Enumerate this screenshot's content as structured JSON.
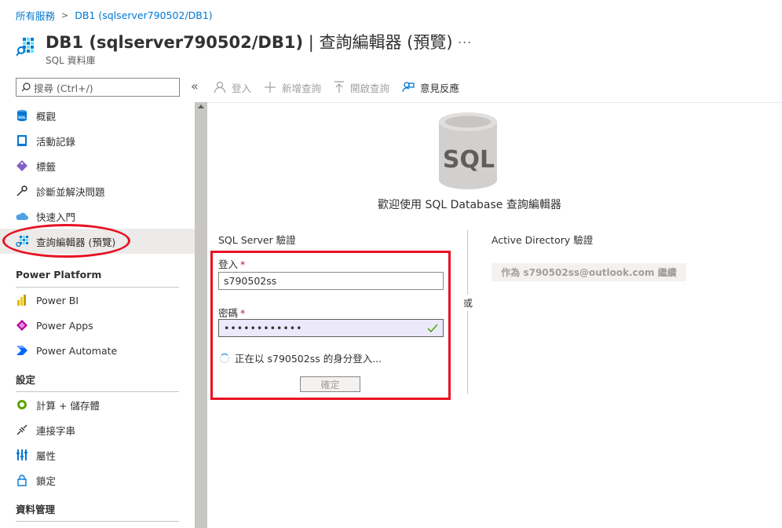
{
  "breadcrumb": {
    "root": "所有服務",
    "current": "DB1 (sqlserver790502/DB1)"
  },
  "header": {
    "title_bold": "DB1 (sqlserver790502/DB1)",
    "title_rest": " | 查詢編輯器 (預覽)",
    "more": "...",
    "subtitle": "SQL 資料庫"
  },
  "search": {
    "placeholder": "搜尋 (Ctrl+/)",
    "collapse": "«"
  },
  "sidebar": {
    "items_top": [
      {
        "label": "概觀",
        "icon": "sql-db-icon"
      },
      {
        "label": "活動記錄",
        "icon": "activity-log-icon"
      },
      {
        "label": "標籤",
        "icon": "tag-icon"
      },
      {
        "label": "診斷並解決問題",
        "icon": "wrench-icon"
      },
      {
        "label": "快速入門",
        "icon": "cloud-icon"
      },
      {
        "label": "查詢編輯器 (預覽)",
        "icon": "query-editor-icon"
      }
    ],
    "section_power": "Power Platform",
    "items_power": [
      {
        "label": "Power BI",
        "icon": "power-bi-icon"
      },
      {
        "label": "Power Apps",
        "icon": "power-apps-icon"
      },
      {
        "label": "Power Automate",
        "icon": "power-automate-icon"
      }
    ],
    "section_settings": "設定",
    "items_settings": [
      {
        "label": "計算 + 儲存體",
        "icon": "compute-icon"
      },
      {
        "label": "連接字串",
        "icon": "plug-icon"
      },
      {
        "label": "屬性",
        "icon": "properties-icon"
      },
      {
        "label": "鎖定",
        "icon": "lock-icon"
      }
    ],
    "section_data": "資料管理"
  },
  "toolbar": {
    "login": "登入",
    "new_query": "新增查詢",
    "open_query": "開啟查詢",
    "feedback": "意見反應"
  },
  "main": {
    "sql_logo_text": "SQL",
    "welcome": "歡迎使用 SQL Database 查詢編輯器",
    "sql_auth_title": "SQL Server 驗證",
    "ad_auth_title": "Active Directory 驗證",
    "or": "或",
    "login_label": "登入",
    "login_value": "s790502ss",
    "password_label": "密碼",
    "password_value": "••••••••••••",
    "required_mark": "*",
    "status": "正在以 s790502ss 的身分登入...",
    "ok": "確定",
    "ad_continue": "作為 s790502ss@outlook.com 繼續"
  },
  "colors": {
    "accent": "#0078d4",
    "highlight": "#e81123"
  }
}
